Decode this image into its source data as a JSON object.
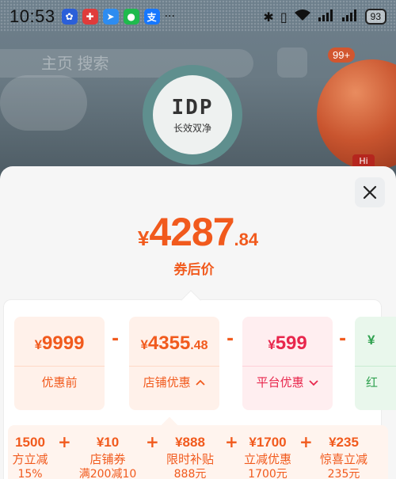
{
  "status_bar": {
    "time": "10:53",
    "battery": "93",
    "more": "···",
    "signal_text": "5G"
  },
  "background": {
    "search_text": "主页 搜索",
    "badge": "99+",
    "logo_text": "IDP",
    "logo_subtitle": "长效双净",
    "tag": "Hi"
  },
  "sheet": {
    "final_price": {
      "symbol": "¥",
      "integer": "4287",
      "decimal": ".84"
    },
    "final_label": "券后价",
    "breakdown": [
      {
        "symbol": "¥",
        "integer": "9999",
        "decimal": "",
        "label": "优惠前"
      },
      {
        "symbol": "¥",
        "integer": "4355",
        "decimal": ".48",
        "label": "店铺优惠",
        "chevron": "up"
      },
      {
        "symbol": "¥",
        "integer": "599",
        "decimal": "",
        "label": "平台优惠",
        "chevron": "down"
      },
      {
        "symbol": "¥",
        "integer": "",
        "decimal": "",
        "label": "红"
      }
    ],
    "operator": "-",
    "plus": "+",
    "store_discounts": [
      {
        "amount": "1500",
        "name": "方立减",
        "note": "15%"
      },
      {
        "amount": "¥10",
        "name": "店铺券",
        "note": "满200减10"
      },
      {
        "amount": "¥888",
        "name": "限时补贴",
        "note": "888元"
      },
      {
        "amount": "¥1700",
        "name": "立减优惠",
        "note": "1700元"
      },
      {
        "amount": "¥235",
        "name": "惊喜立减",
        "note": "235元"
      }
    ]
  },
  "colors": {
    "accent": "#f15a1d",
    "platform": "#e8274d",
    "red_packet": "#2fa14f"
  }
}
